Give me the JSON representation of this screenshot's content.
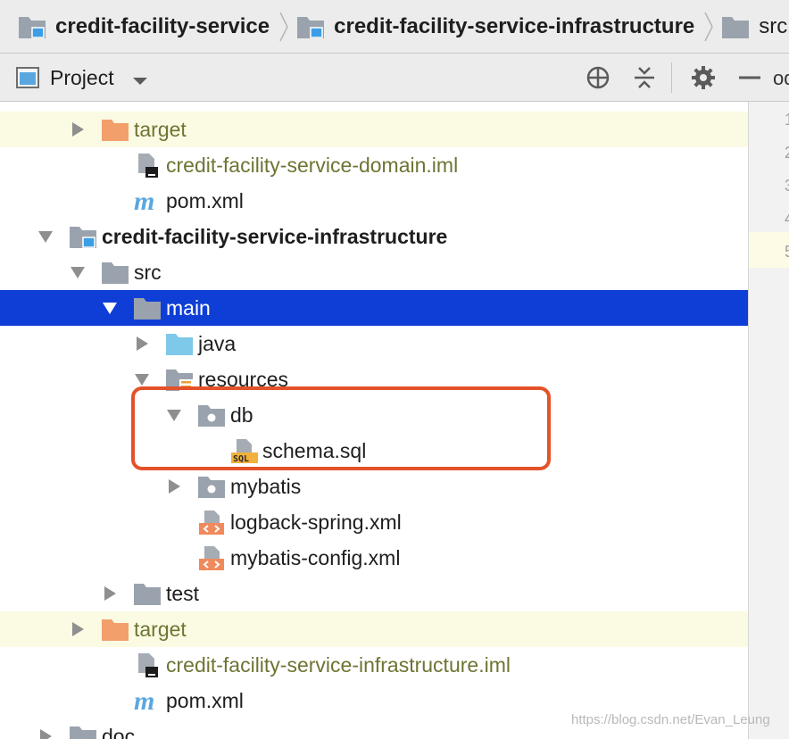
{
  "breadcrumb": [
    {
      "label": "credit-facility-service",
      "icon": "module-folder-icon",
      "bold": true
    },
    {
      "label": "credit-facility-service-infrastructure",
      "icon": "module-folder-icon",
      "bold": true
    },
    {
      "label": "src",
      "icon": "folder-icon",
      "bold": false
    }
  ],
  "toolbar": {
    "title": "Project",
    "buttons": [
      "locate-icon",
      "collapse-all-icon",
      "gear-icon",
      "minimize-icon"
    ]
  },
  "editor": {
    "tab_partial": "od",
    "line_numbers": [
      "1",
      "2",
      "3",
      "4",
      "5"
    ]
  },
  "tree": [
    {
      "label": "target",
      "icon": "folder-excluded-icon",
      "arrow": "right",
      "style": "olive",
      "bg": "excluded"
    },
    {
      "label": "credit-facility-service-domain.iml",
      "icon": "iml-file-icon",
      "arrow": "",
      "style": "olive",
      "bg": ""
    },
    {
      "label": "pom.xml",
      "icon": "maven-icon",
      "arrow": "",
      "style": "normal",
      "bg": ""
    },
    {
      "label": "credit-facility-service-infrastructure",
      "icon": "module-folder-icon",
      "arrow": "down",
      "style": "bold",
      "bg": ""
    },
    {
      "label": "src",
      "icon": "folder-icon",
      "arrow": "down",
      "style": "normal",
      "bg": ""
    },
    {
      "label": "main",
      "icon": "folder-icon",
      "arrow": "down",
      "style": "normal",
      "bg": "selected"
    },
    {
      "label": "java",
      "icon": "source-folder-icon",
      "arrow": "right",
      "style": "normal",
      "bg": ""
    },
    {
      "label": "resources",
      "icon": "resources-folder-icon",
      "arrow": "down",
      "style": "normal",
      "bg": ""
    },
    {
      "label": "db",
      "icon": "package-folder-icon",
      "arrow": "down",
      "style": "normal",
      "bg": ""
    },
    {
      "label": "schema.sql",
      "icon": "sql-file-icon",
      "arrow": "",
      "style": "normal",
      "bg": ""
    },
    {
      "label": "mybatis",
      "icon": "package-folder-icon",
      "arrow": "right",
      "style": "normal",
      "bg": ""
    },
    {
      "label": "logback-spring.xml",
      "icon": "xml-file-icon",
      "arrow": "",
      "style": "normal",
      "bg": ""
    },
    {
      "label": "mybatis-config.xml",
      "icon": "xml-file-icon",
      "arrow": "",
      "style": "normal",
      "bg": ""
    },
    {
      "label": "test",
      "icon": "folder-icon",
      "arrow": "right",
      "style": "normal",
      "bg": ""
    },
    {
      "label": "target",
      "icon": "folder-excluded-icon",
      "arrow": "right",
      "style": "olive",
      "bg": "excluded"
    },
    {
      "label": "credit-facility-service-infrastructure.iml",
      "icon": "iml-file-icon",
      "arrow": "",
      "style": "olive",
      "bg": ""
    },
    {
      "label": "pom.xml",
      "icon": "maven-icon",
      "arrow": "",
      "style": "normal",
      "bg": ""
    },
    {
      "label": "doc",
      "icon": "folder-icon",
      "arrow": "right",
      "style": "normal",
      "bg": ""
    }
  ],
  "watermark": "https://blog.csdn.net/Evan_Leung",
  "colors": {
    "selection": "#0f3ed6",
    "excluded_row": "#fbfbe4",
    "excluded_label": "#6f7433",
    "highlight_box": "#e4522a"
  }
}
